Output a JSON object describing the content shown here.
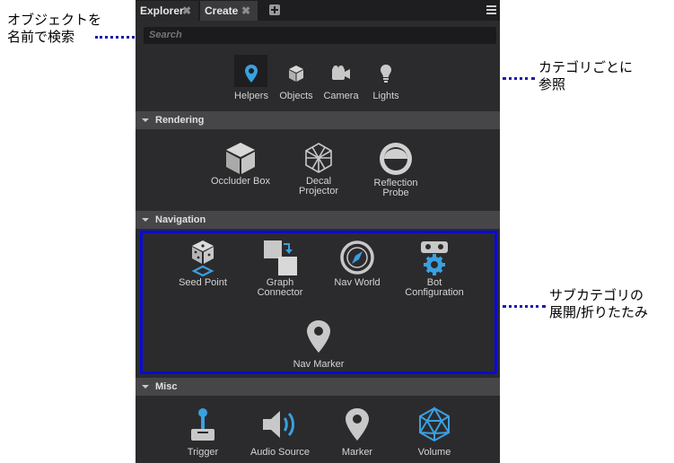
{
  "annotations": {
    "search_note": [
      "オブジェクトを",
      "名前で検索"
    ],
    "category_note": [
      "カテゴリごとに",
      "参照"
    ],
    "subcategory_note": [
      "サブカテゴリの",
      "展開/折りたたみ"
    ]
  },
  "tabs": {
    "explorer": "Explorer",
    "create": "Create"
  },
  "search": {
    "placeholder": "Search"
  },
  "categories": [
    {
      "label": "Helpers",
      "icon": "location-pin-icon",
      "selected": true
    },
    {
      "label": "Objects",
      "icon": "cube-icon"
    },
    {
      "label": "Camera",
      "icon": "camera-icon"
    },
    {
      "label": "Lights",
      "icon": "lightbulb-icon"
    }
  ],
  "sections": {
    "rendering": {
      "title": "Rendering",
      "items": [
        {
          "label_lines": [
            "Occluder Box"
          ],
          "icon": "cube-icon"
        },
        {
          "label_lines": [
            "Decal",
            "Projector"
          ],
          "icon": "wireframe-cube-icon"
        },
        {
          "label_lines": [
            "Reflection",
            "Probe"
          ],
          "icon": "reflection-sphere-icon"
        }
      ]
    },
    "navigation": {
      "title": "Navigation",
      "items": [
        {
          "label_lines": [
            "Seed Point"
          ],
          "icon": "dice-seed-icon"
        },
        {
          "label_lines": [
            "Graph",
            "Connector"
          ],
          "icon": "graph-connector-icon"
        },
        {
          "label_lines": [
            "Nav World"
          ],
          "icon": "compass-icon"
        },
        {
          "label_lines": [
            "Bot",
            "Configuration"
          ],
          "icon": "bot-gear-icon"
        },
        {
          "label_lines": [
            "Nav Marker"
          ],
          "icon": "location-pin-icon"
        }
      ]
    },
    "misc": {
      "title": "Misc",
      "items": [
        {
          "label_lines": [
            "Trigger"
          ],
          "icon": "joystick-icon"
        },
        {
          "label_lines": [
            "Audio Source"
          ],
          "icon": "speaker-icon"
        },
        {
          "label_lines": [
            "Marker"
          ],
          "icon": "location-pin-icon"
        },
        {
          "label_lines": [
            "Volume"
          ],
          "icon": "volume-icosahedron-icon"
        }
      ]
    }
  },
  "colors": {
    "panel_bg": "#2b2b2d",
    "section_bg": "#464649",
    "accent_blue": "#3aa0e0",
    "icon_gray": "#c8c8c8",
    "highlight_border": "#0a0ad6",
    "annotation_dots": "#1a1aa6"
  }
}
